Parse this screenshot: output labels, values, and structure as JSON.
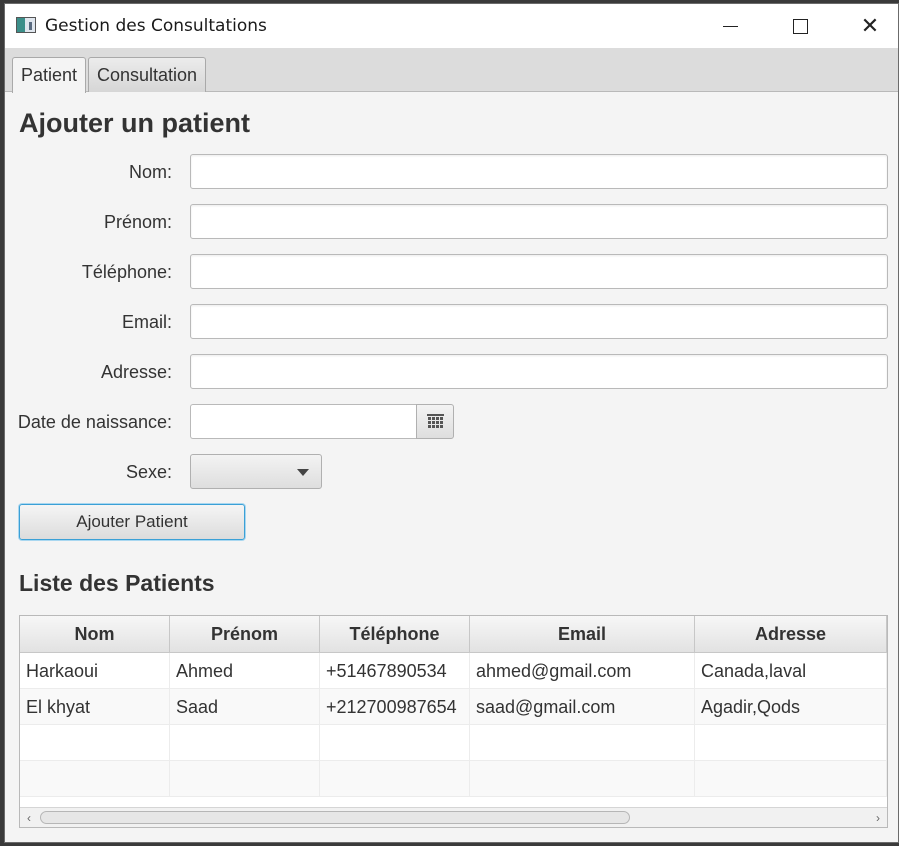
{
  "window": {
    "title": "Gestion des Consultations"
  },
  "tabs": [
    "Patient",
    "Consultation"
  ],
  "form": {
    "title": "Ajouter un patient",
    "nom_label": "Nom:",
    "prenom_label": "Prénom:",
    "telephone_label": "Téléphone:",
    "email_label": "Email:",
    "adresse_label": "Adresse:",
    "date_label": "Date de naissance:",
    "sexe_label": "Sexe:",
    "values": {
      "nom": "",
      "prenom": "",
      "telephone": "",
      "email": "",
      "adresse": "",
      "date": "",
      "sexe": ""
    },
    "submit_label": "Ajouter Patient"
  },
  "list": {
    "title": "Liste des Patients",
    "columns": [
      "Nom",
      "Prénom",
      "Téléphone",
      "Email",
      "Adresse"
    ],
    "rows": [
      [
        "Harkaoui",
        "Ahmed",
        "+51467890534",
        "ahmed@gmail.com",
        "Canada,laval"
      ],
      [
        "El khyat",
        "Saad",
        "+212700987654",
        "saad@gmail.com",
        "Agadir,Qods"
      ],
      [
        "",
        "",
        "",
        "",
        ""
      ],
      [
        "",
        "",
        "",
        "",
        ""
      ]
    ]
  },
  "icons": {
    "app": "app-window-icon",
    "minimize": "minimize-icon",
    "maximize": "maximize-icon",
    "close": "close-icon",
    "calendar": "calendar-icon",
    "dropdown": "chevron-down-icon",
    "scroll_left": "chevron-left-icon",
    "scroll_right": "chevron-right-icon"
  },
  "glyphs": {
    "close": "✕",
    "scroll_left": "‹",
    "scroll_right": "›"
  },
  "colors": {
    "focus_border": "#3ba0d6",
    "window_bg": "#f4f4f4"
  }
}
